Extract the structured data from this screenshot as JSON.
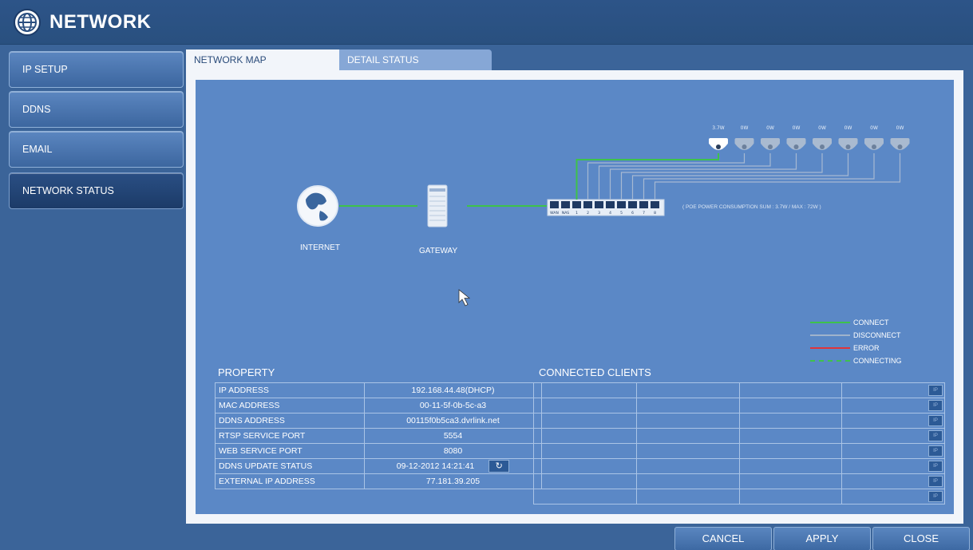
{
  "header": {
    "title": "NETWORK"
  },
  "sidebar": {
    "items": [
      {
        "label": "IP SETUP"
      },
      {
        "label": "DDNS"
      },
      {
        "label": "EMAIL"
      },
      {
        "label": "NETWORK STATUS"
      }
    ]
  },
  "tabs": [
    {
      "label": "NETWORK MAP"
    },
    {
      "label": "DETAIL STATUS"
    }
  ],
  "map": {
    "internet_label": "INTERNET",
    "gateway_label": "GATEWAY",
    "poe_text": "( POE POWER CONSUMPTION  SUM : 3.7W / MAX : 72W )",
    "switch_ports": [
      "WAN",
      "NAS",
      "1",
      "2",
      "3",
      "4",
      "5",
      "6",
      "7",
      "8"
    ],
    "camera_watts": [
      "3.7W",
      "0W",
      "0W",
      "0W",
      "0W",
      "0W",
      "0W",
      "0W"
    ],
    "legend": [
      {
        "label": "CONNECT",
        "color": "#3ec24b"
      },
      {
        "label": "DISCONNECT",
        "color": "#9fb3cc"
      },
      {
        "label": "ERROR",
        "color": "#e0343a"
      },
      {
        "label": "CONNECTING",
        "color": "#3ec24b"
      }
    ]
  },
  "property": {
    "title": "PROPERTY",
    "rows": [
      {
        "key": "IP ADDRESS",
        "value": "192.168.44.48(DHCP)"
      },
      {
        "key": "MAC ADDRESS",
        "value": "00-11-5f-0b-5c-a3"
      },
      {
        "key": "DDNS ADDRESS",
        "value": "00115f0b5ca3.dvrlink.net"
      },
      {
        "key": "RTSP SERVICE PORT",
        "value": "5554"
      },
      {
        "key": "WEB SERVICE PORT",
        "value": "8080"
      },
      {
        "key": "DDNS UPDATE STATUS",
        "value": "09-12-2012  14:21:41"
      },
      {
        "key": "EXTERNAL IP ADDRESS",
        "value": "77.181.39.205"
      }
    ],
    "refresh_icon": "↻"
  },
  "clients": {
    "title": "CONNECTED CLIENTS",
    "row_count": 8,
    "button_label": "IP"
  },
  "footer": {
    "cancel": "CANCEL",
    "apply": "APPLY",
    "close": "CLOSE"
  }
}
